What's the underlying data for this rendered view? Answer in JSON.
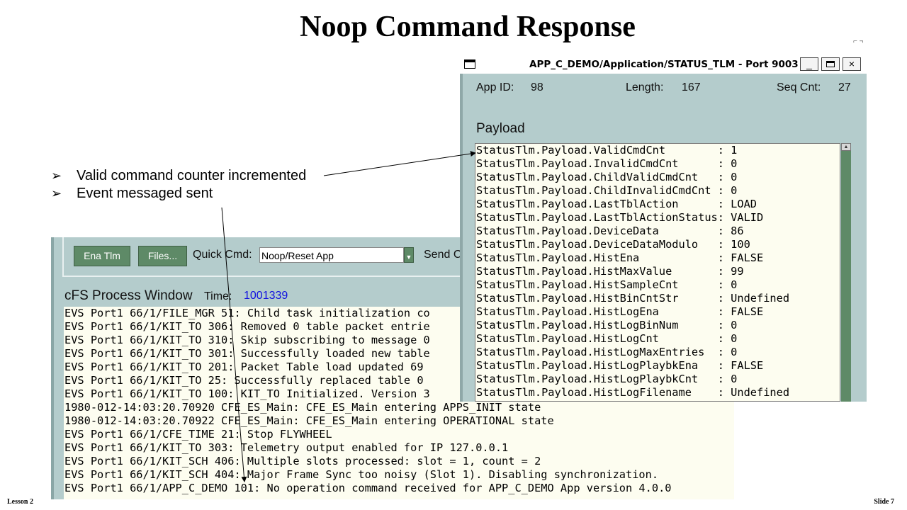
{
  "slide": {
    "title": "Noop Command Response",
    "bullets": [
      {
        "marker": "➢",
        "text": "Valid command counter incremented"
      },
      {
        "marker": "➢",
        "text": "Event messaged sent"
      }
    ],
    "footer_left": "Lesson 2",
    "footer_right": "Slide 7"
  },
  "cfs_window": {
    "buttons": {
      "ena_tlm": "Ena Tlm",
      "files": "Files..."
    },
    "quick_cmd_label": "Quick Cmd:",
    "quick_cmd_value": "Noop/Reset App",
    "send_label": "Send Cm",
    "title": "cFS Process Window",
    "time_label": "Time:",
    "time_value": "1001339",
    "log": [
      "EVS Port1 66/1/FILE_MGR 51: Child task initialization co",
      "EVS Port1 66/1/KIT_TO 306: Removed 0 table packet entrie",
      "EVS Port1 66/1/KIT_TO 310: Skip subscribing to message 0",
      "EVS Port1 66/1/KIT_TO 301: Successfully loaded new table",
      "EVS Port1 66/1/KIT_TO 201: Packet Table load updated 69 ",
      "EVS Port1 66/1/KIT_TO 25: Successfully replaced table 0 ",
      "EVS Port1 66/1/KIT_TO 100: KIT_TO Initialized. Version 3",
      "1980-012-14:03:20.70920 CFE_ES_Main: CFE_ES_Main entering APPS_INIT state",
      "1980-012-14:03:20.70922 CFE_ES_Main: CFE_ES_Main entering OPERATIONAL state",
      "EVS Port1 66/1/CFE_TIME 21: Stop FLYWHEEL",
      "EVS Port1 66/1/KIT_TO 303: Telemetry output enabled for IP 127.0.0.1",
      "EVS Port1 66/1/KIT_SCH 406: Multiple slots processed: slot = 1, count = 2",
      "EVS Port1 66/1/KIT_SCH 404: Major Frame Sync too noisy (Slot 1). Disabling synchronization.",
      "EVS Port1 66/1/APP_C_DEMO 101: No operation command received for APP_C_DEMO App version 4.0.0"
    ]
  },
  "tlm_window": {
    "title": "APP_C_DEMO/Application/STATUS_TLM - Port 9003",
    "controls": {
      "minimize": "_",
      "close": "×"
    },
    "app_id_label": "App ID:",
    "app_id_value": "98",
    "length_label": "Length:",
    "length_value": "167",
    "seq_cnt_label": "Seq Cnt:",
    "seq_cnt_value": "27",
    "payload_label": "Payload",
    "payload": [
      "StatusTlm.Payload.ValidCmdCnt        : 1",
      "StatusTlm.Payload.InvalidCmdCnt      : 0",
      "StatusTlm.Payload.ChildValidCmdCnt   : 0",
      "StatusTlm.Payload.ChildInvalidCmdCnt : 0",
      "StatusTlm.Payload.LastTblAction      : LOAD",
      "StatusTlm.Payload.LastTblActionStatus: VALID",
      "StatusTlm.Payload.DeviceData         : 86",
      "StatusTlm.Payload.DeviceDataModulo   : 100",
      "StatusTlm.Payload.HistEna            : FALSE",
      "StatusTlm.Payload.HistMaxValue       : 99",
      "StatusTlm.Payload.HistSampleCnt      : 0",
      "StatusTlm.Payload.HistBinCntStr      : Undefined",
      "StatusTlm.Payload.HistLogEna         : FALSE",
      "StatusTlm.Payload.HistLogBinNum      : 0",
      "StatusTlm.Payload.HistLogCnt         : 0",
      "StatusTlm.Payload.HistLogMaxEntries  : 0",
      "StatusTlm.Payload.HistLogPlaybkEna   : FALSE",
      "StatusTlm.Payload.HistLogPlaybkCnt   : 0",
      "StatusTlm.Payload.HistLogFilename    : Undefined"
    ]
  },
  "colors": {
    "window_bg": "#b4cccc",
    "button_green": "#5e8a67",
    "log_bg": "#fdfdf0",
    "time_value": "#1010e0"
  },
  "icons": [
    "window-menu-icon",
    "minimize-icon",
    "maximize-icon",
    "close-icon",
    "dropdown-arrow-icon",
    "scroll-up-icon",
    "bullet-arrow-icon"
  ]
}
